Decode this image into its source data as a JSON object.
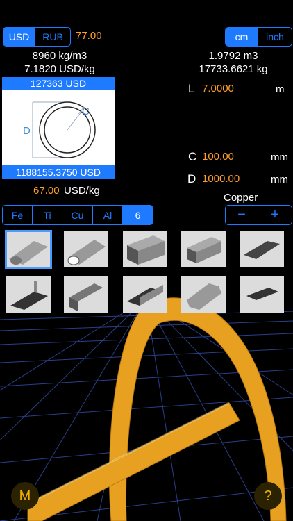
{
  "currency": {
    "options": [
      "USD",
      "RUB"
    ],
    "selected": "USD",
    "rate": "77.00"
  },
  "units": {
    "options": [
      "cm",
      "inch"
    ],
    "selected": "cm"
  },
  "left": {
    "density": "8960 kg/m3",
    "price_per_kg": "7.1820 USD/kg",
    "top_price": "127363 USD",
    "bottom_price": "1188155.3750 USD",
    "price_input": "67.00",
    "price_unit": "USD/kg",
    "diagram_labels": {
      "d": "D",
      "c": "C"
    }
  },
  "right": {
    "volume": "1.9792 m3",
    "weight": "17733.6621 kg",
    "length": {
      "label": "L",
      "value": "7.0000",
      "unit": "m"
    },
    "c": {
      "label": "C",
      "value": "100.00",
      "unit": "mm"
    },
    "d": {
      "label": "D",
      "value": "1000.00",
      "unit": "mm"
    }
  },
  "material": {
    "name": "Copper",
    "minus": "−",
    "plus": "+"
  },
  "metals": {
    "options": [
      "Fe",
      "Ti",
      "Cu",
      "Al",
      "6"
    ],
    "selected": "6"
  },
  "bottom": {
    "menu_label": "M",
    "help_label": "?"
  },
  "colors": {
    "accent": "#1e7bff",
    "orange": "#ff9e2c",
    "gold": "#e8a020"
  },
  "shapes": [
    "round-bar",
    "pipe",
    "square-tube",
    "square-bar",
    "flat-plate",
    "angle",
    "channel",
    "i-beam",
    "hex-bar",
    "sheet"
  ]
}
